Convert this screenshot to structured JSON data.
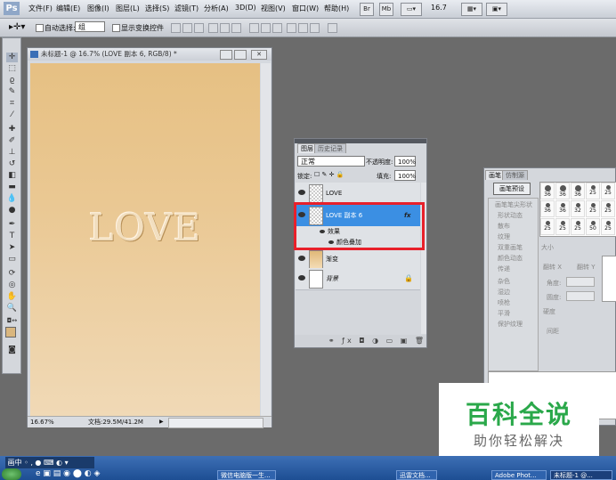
{
  "app": {
    "logo": "Ps"
  },
  "menu": [
    "文件(F)",
    "编辑(E)",
    "图像(I)",
    "图层(L)",
    "选择(S)",
    "滤镜(T)",
    "分析(A)",
    "3D(D)",
    "视图(V)",
    "窗口(W)",
    "帮助(H)"
  ],
  "menubar_buttons": {
    "br": "Br",
    "mb": "Mb",
    "zoom": "16.7"
  },
  "options": {
    "auto_select_label": "自动选择:",
    "auto_select_value": "组",
    "transform_label": "显示变换控件"
  },
  "document": {
    "title": "未标题-1 @ 16.7% (LOVE 副本 6, RGB/8) *",
    "canvas_text": "LOVE",
    "zoom": "16.67%",
    "doc_info": "文档:29.5M/41.2M"
  },
  "layers_panel": {
    "tabs": [
      "图层",
      "历史记录"
    ],
    "blend_mode": "正常",
    "opacity_label": "不透明度:",
    "opacity": "100%",
    "lock_label": "锁定:",
    "fill_label": "填充:",
    "fill": "100%",
    "layers": [
      {
        "name": "LOVE",
        "selected": false
      },
      {
        "name": "LOVE 副本 6",
        "selected": true,
        "fx": "fx"
      },
      {
        "name": "效果",
        "sub": true
      },
      {
        "name": "颜色叠加",
        "sub": true
      },
      {
        "name": "渐变",
        "selected": false
      },
      {
        "name": "背景",
        "selected": false
      }
    ],
    "highlight_color": "#e8202a"
  },
  "brush_panel": {
    "tabs": [
      "画笔",
      "仿制源"
    ],
    "preset_button": "画笔预设",
    "options": [
      "画笔笔尖形状",
      "形状动态",
      "散布",
      "纹理",
      "双重画笔",
      "颜色动态",
      "传递",
      "杂色",
      "湿边",
      "喷枪",
      "平滑",
      "保护纹理"
    ],
    "size_label": "大小",
    "flip_x": "翻转 X",
    "flip_y": "翻转 Y",
    "angle": "角度:",
    "roundness": "圆度:",
    "hardness": "硬度",
    "spacing": "间距",
    "brush_sizes": [
      "36",
      "36",
      "36",
      "25",
      "25",
      "36",
      "36",
      "32",
      "25",
      "25",
      "25",
      "25",
      "25",
      "50",
      "25"
    ]
  },
  "watermark": {
    "title": "百科全说",
    "subtitle": "助你轻松解决"
  },
  "taskbar": {
    "tasks": [
      "微信电脑版一生...",
      "迅雷文档...",
      "Adobe Phot...",
      "未标题-1 @..."
    ]
  }
}
